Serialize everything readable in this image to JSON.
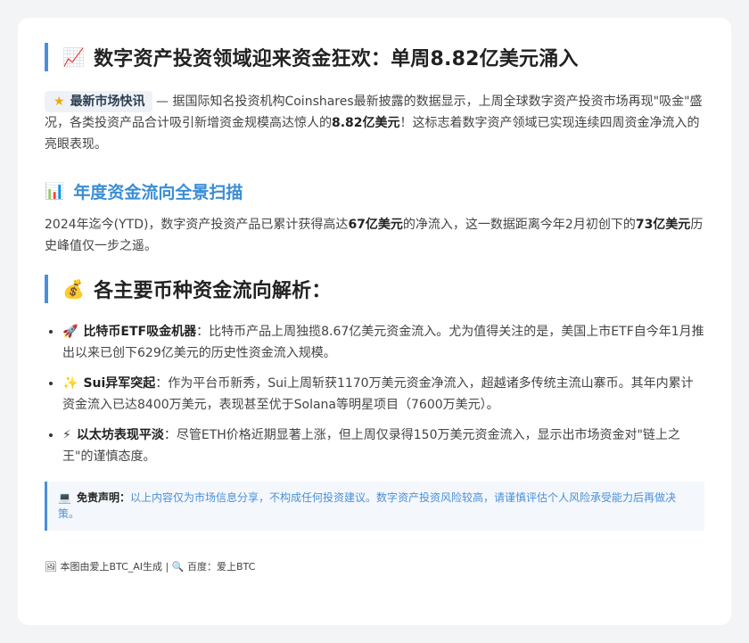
{
  "title": {
    "icon": "📈",
    "text": "数字资产投资领域迎来资金狂欢：单周8.82亿美元涌入"
  },
  "news": {
    "tag_icon": "★",
    "tag_label": "最新市场快讯",
    "text_1": " — 据国际知名投资机构Coinshares最新披露的数据显示，上周全球数字资产投资市场再现\"吸金\"盛况，各类投资产品合计吸引新增资金规模高达惊人的",
    "highlight": "8.82亿美元",
    "text_2": "！这标志着数字资产领域已实现连续四周资金净流入的亮眼表现。"
  },
  "annual": {
    "icon": "📊",
    "heading": "年度资金流向全景扫描",
    "text_1": "2024年迄今(YTD)，数字资产投资产品已累计获得高达",
    "highlight_1": "67亿美元",
    "text_2": "的净流入，这一数据距离今年2月初创下的",
    "highlight_2": "73亿美元",
    "text_3": "历史峰值仅一步之遥。"
  },
  "flows": {
    "icon": "💰",
    "heading": "各主要币种资金流向解析：",
    "items": [
      {
        "icon": "🚀",
        "title": "比特币ETF吸金机器",
        "text": "：比特币产品上周独揽8.67亿美元资金流入。尤为值得关注的是，美国上市ETF自今年1月推出以来已创下629亿美元的历史性资金流入规模。"
      },
      {
        "icon": "✨",
        "title": "Sui异军突起",
        "text": "：作为平台币新秀，Sui上周斩获1170万美元资金净流入，超越诸多传统主流山寨币。其年内累计资金流入已达8400万美元，表现甚至优于Solana等明星项目（7600万美元）。"
      },
      {
        "icon": "⚡",
        "title": "以太坊表现平淡",
        "text": "：尽管ETH价格近期显著上涨，但上周仅录得150万美元资金流入，显示出市场资金对\"链上之王\"的谨慎态度。"
      }
    ]
  },
  "disclaimer": {
    "icon": "💻",
    "label": "免责声明：",
    "text": "以上内容仅为市场信息分享，不构成任何投资建议。数字资产投资风险较高，请谨慎评估个人风险承受能力后再做决策。"
  },
  "footer": {
    "image_icon": "🖼",
    "text_1": "本图由爱上BTC_AI生成 | ",
    "search_icon": "🔍",
    "text_2": " 百度：爱上BTC"
  },
  "colors": {
    "accent": "#4a90d9",
    "heading_blue": "#3b8ed5",
    "background": "#f3f4f6"
  }
}
